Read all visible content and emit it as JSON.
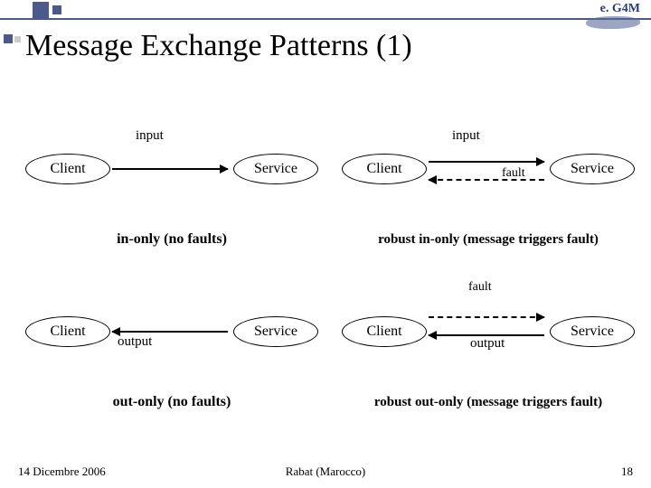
{
  "logo_text": "e. G4M",
  "title": "Message Exchange Patterns (1)",
  "labels": {
    "client": "Client",
    "service": "Service",
    "input": "input",
    "output": "output",
    "fault": "fault"
  },
  "captions": {
    "q1": "in-only (no faults)",
    "q2": "robust in-only (message triggers fault)",
    "q3": "out-only (no faults)",
    "q4": "robust out-only (message triggers fault)"
  },
  "footer": {
    "left": "14 Dicembre 2006",
    "center": "Rabat (Marocco)",
    "right": "18"
  }
}
